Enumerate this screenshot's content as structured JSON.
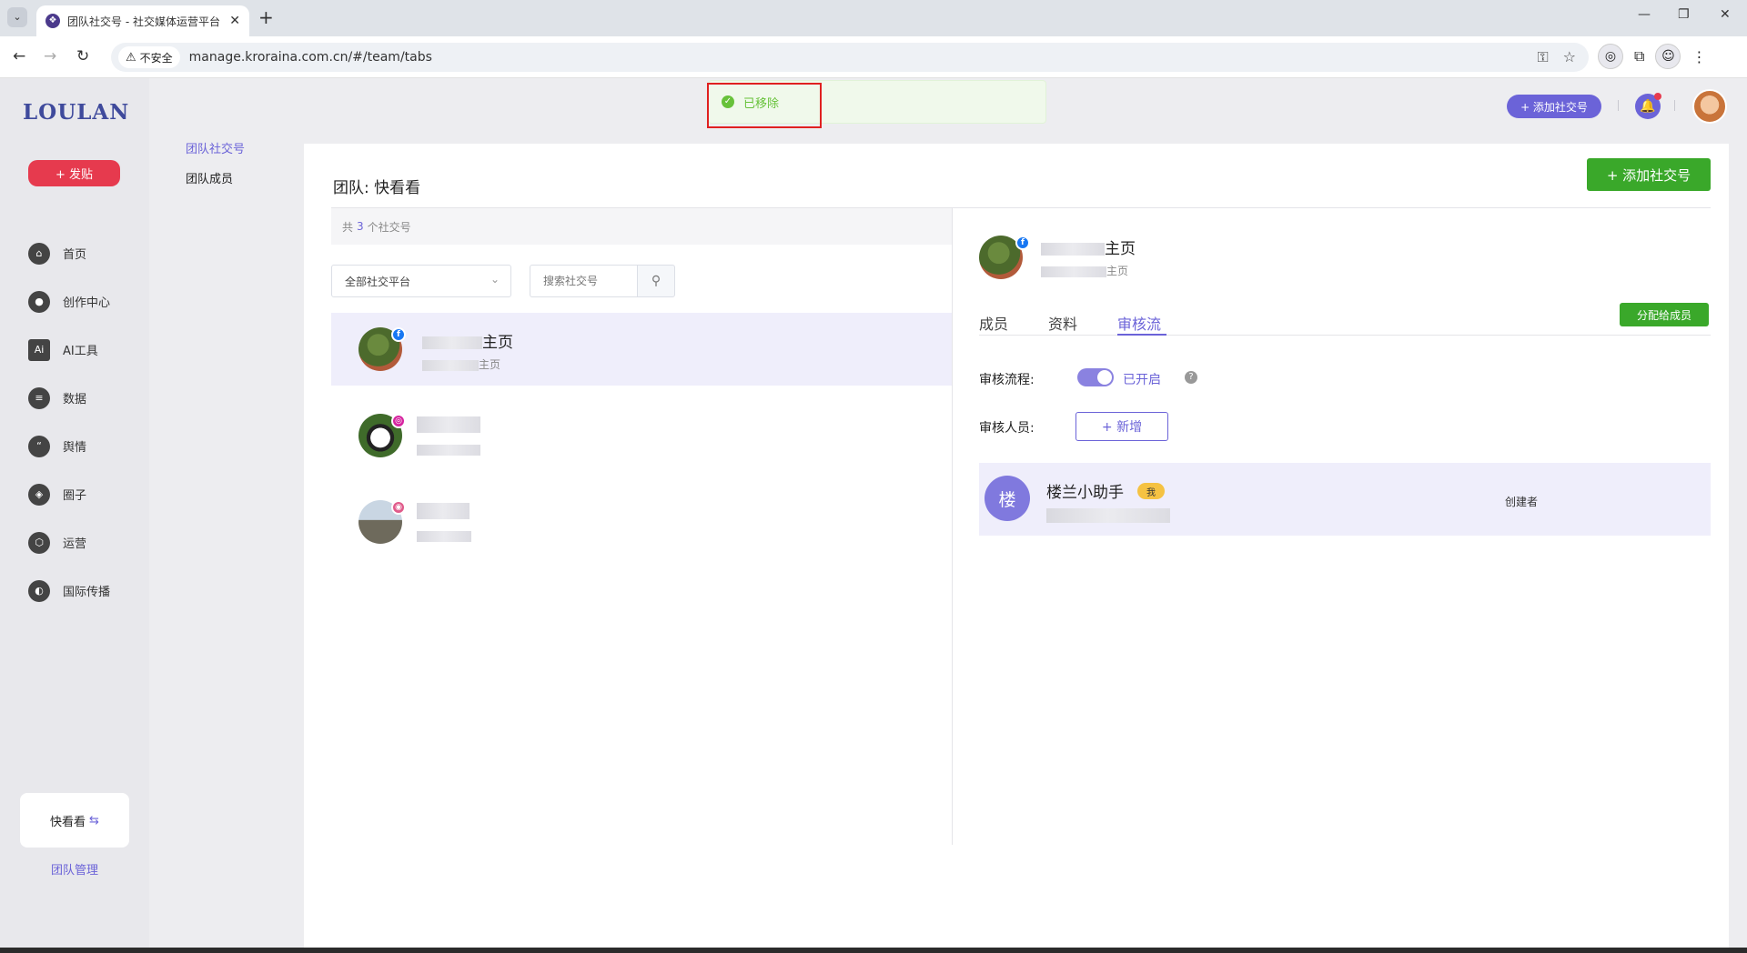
{
  "browser": {
    "tab_title": "团队社交号 - 社交媒体运营平台",
    "insecure_label": "不安全",
    "url": "manage.kroraina.com.cn/#/team/tabs"
  },
  "sidebar": {
    "logo": "LOULAN",
    "post_button": "+ 发贴",
    "items": [
      {
        "label": "首页",
        "icon": "home-icon"
      },
      {
        "label": "创作中心",
        "icon": "palette-icon"
      },
      {
        "label": "AI工具",
        "icon": "ai-icon"
      },
      {
        "label": "数据",
        "icon": "database-icon"
      },
      {
        "label": "舆情",
        "icon": "quote-icon"
      },
      {
        "label": "圈子",
        "icon": "compass-icon"
      },
      {
        "label": "运营",
        "icon": "network-icon"
      },
      {
        "label": "国际传播",
        "icon": "globe-icon"
      }
    ],
    "team_name": "快看看",
    "team_switch_icon": "⇆",
    "team_manage": "团队管理"
  },
  "subnav": {
    "items": [
      "团队社交号",
      "团队成员"
    ]
  },
  "toast": {
    "message": "已移除"
  },
  "header": {
    "add_social": "+ 添加社交号"
  },
  "main": {
    "title": "团队: 快看看",
    "add_button": "+ 添加社交号",
    "count_prefix": "共",
    "count": "3",
    "count_suffix": "个社交号",
    "platform_filter": "全部社交平台",
    "search_placeholder": "搜索社交号",
    "accounts": [
      {
        "name_suffix": "主页",
        "sub_suffix": "主页",
        "platform": "facebook",
        "badge": "f",
        "badge_color": "#1877f2"
      },
      {
        "name_suffix": "",
        "sub_suffix": "",
        "platform": "instagram",
        "badge": "◎",
        "badge_color": "#d6249f"
      },
      {
        "name_suffix": "",
        "sub_suffix": "",
        "platform": "other",
        "badge": "◉",
        "badge_color": "#e05a8a"
      }
    ]
  },
  "detail": {
    "name_suffix": "主页",
    "sub_suffix": "主页",
    "tabs": [
      "成员",
      "资料",
      "审核流"
    ],
    "active_tab": "审核流",
    "assign_button": "分配给成员",
    "flow_label": "审核流程:",
    "flow_state": "已开启",
    "reviewer_label": "审核人员:",
    "add_reviewer": "+ 新增",
    "reviewer": {
      "avatar_char": "楼",
      "name": "楼兰小助手",
      "me_tag": "我",
      "role": "创建者"
    }
  },
  "colors": {
    "accent": "#6b63d8",
    "green": "#3aa82a",
    "post_red": "#e63a4e"
  }
}
